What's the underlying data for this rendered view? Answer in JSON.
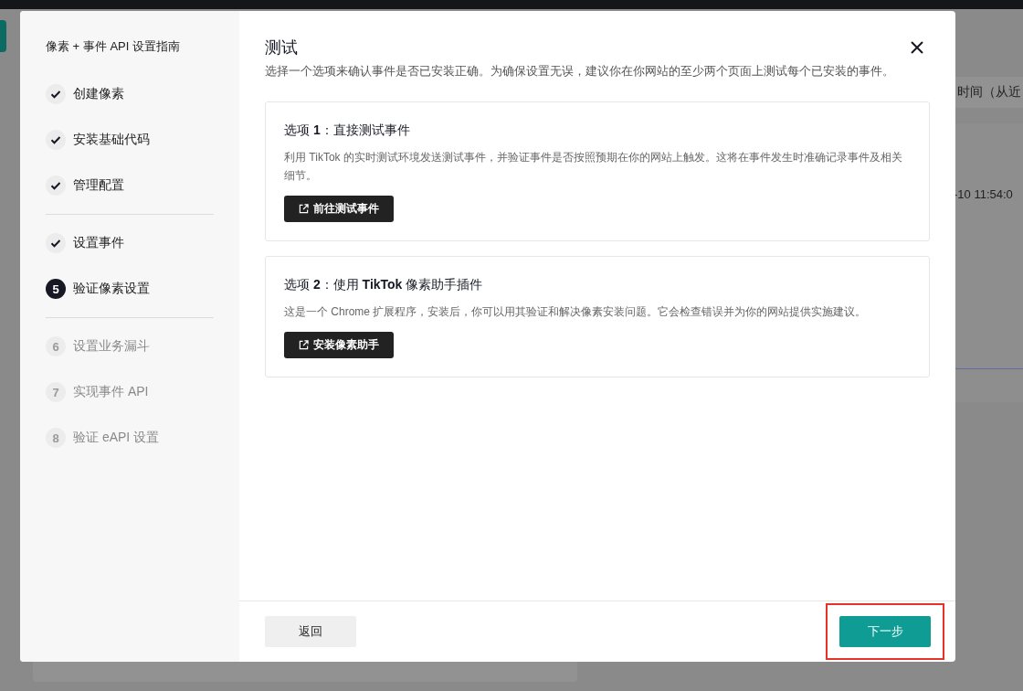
{
  "background": {
    "header_text": "时间（从近",
    "cell_text": "-10 11:54:0"
  },
  "sidebar": {
    "title": "像素 + 事件 API 设置指南",
    "groups": [
      [
        {
          "label": "创建像素",
          "done": true,
          "selected": false
        },
        {
          "label": "安装基础代码",
          "done": true,
          "selected": false
        },
        {
          "label": "管理配置",
          "done": true,
          "selected": false
        }
      ],
      [
        {
          "label": "设置事件",
          "done": true,
          "selected": false
        },
        {
          "label": "验证像素设置",
          "number": "5",
          "done": false,
          "selected": true
        }
      ],
      [
        {
          "label": "设置业务漏斗",
          "number": "6",
          "done": false,
          "selected": false
        },
        {
          "label": "实现事件 API",
          "number": "7",
          "done": false,
          "selected": false
        },
        {
          "label": "验证 eAPI 设置",
          "number": "8",
          "done": false,
          "selected": false
        }
      ]
    ]
  },
  "dialog": {
    "title": "测试",
    "description": "选择一个选项来确认事件是否已安装正确。为确保设置无误，建议你在你网站的至少两个页面上测试每个已安装的事件。",
    "options": [
      {
        "title": "选项 **1**：直接测试事件",
        "text": "利用 TikTok 的实时测试环境发送测试事件，并验证事件是否按照预期在你的网站上触发。这将在事件发生时准确记录事件及相关细节。",
        "button": "前往测试事件"
      },
      {
        "title": "选项 **2**：使用 **TikTok** 像素助手插件",
        "text": "这是一个 Chrome 扩展程序，安装后，你可以用其验证和解决像素安装问题。它会检查错误并为你的网站提供实施建议。",
        "button": "安装像素助手"
      }
    ],
    "back_button": "返回",
    "next_button": "下一步"
  }
}
